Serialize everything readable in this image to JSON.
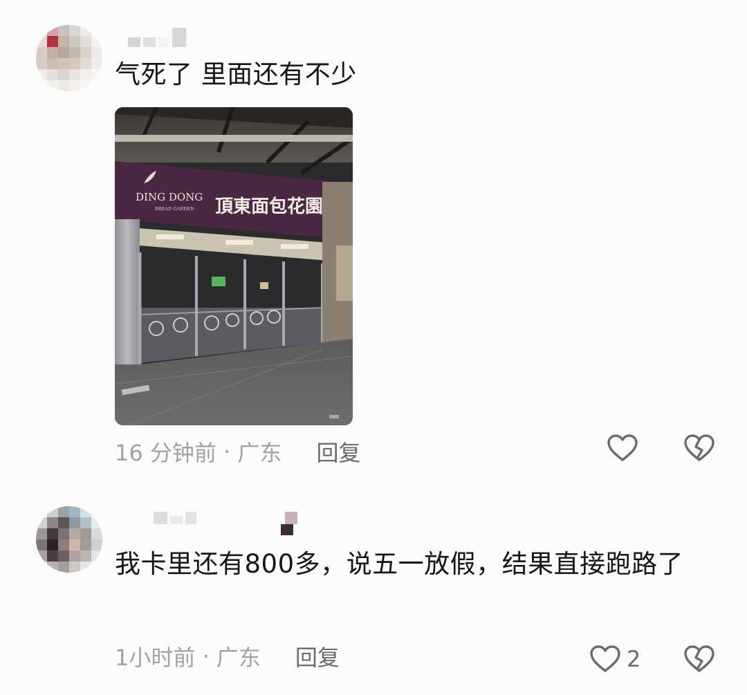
{
  "comments": [
    {
      "text": "气死了 里面还有不少",
      "time": "16 分钟前",
      "location": "广东",
      "reply_label": "回复",
      "like_count": "",
      "photo": {
        "sign_brand": "DING DONG",
        "sign_sub": "BREAD GARDEN",
        "sign_cn": "頂東面包花園"
      }
    },
    {
      "text": "我卡里还有800多，说五一放假，结果直接跑路了",
      "time": "1小时前",
      "location": "广东",
      "reply_label": "回复",
      "like_count": "2"
    }
  ],
  "icons": {
    "like": "heart-outline-icon",
    "dislike": "broken-heart-icon"
  },
  "colors": {
    "background": "#fbfbf9",
    "meta_text": "#a2a2a2",
    "reply_text": "#6a6a6a",
    "icon": "#6b6b6b",
    "sign_purple": "#4a2742"
  }
}
